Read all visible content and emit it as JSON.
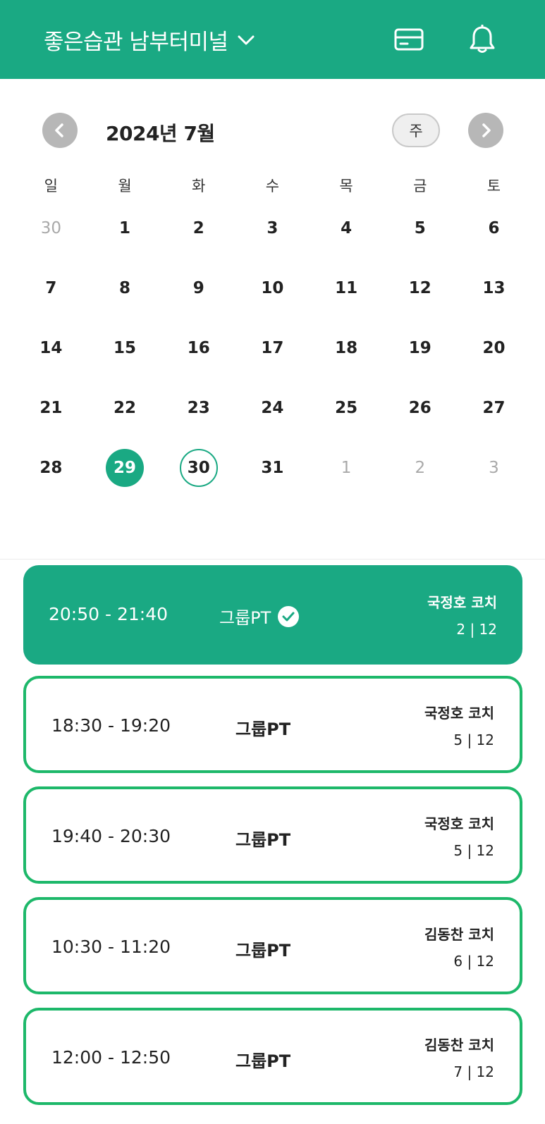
{
  "header": {
    "gym_name": "좋은습관 남부터미널",
    "icons": [
      "chevron-down-icon",
      "membership-card-icon",
      "bell-icon"
    ],
    "bg_color": "#1aa983"
  },
  "calendar": {
    "month_label": "2024년 7월",
    "view_toggle": "주",
    "weekdays": [
      "일",
      "월",
      "화",
      "수",
      "목",
      "금",
      "토"
    ],
    "weeks": [
      [
        "30",
        "1",
        "2",
        "3",
        "4",
        "5",
        "6"
      ],
      [
        "7",
        "8",
        "9",
        "10",
        "11",
        "12",
        "13"
      ],
      [
        "14",
        "15",
        "16",
        "17",
        "18",
        "19",
        "20"
      ],
      [
        "21",
        "22",
        "23",
        "24",
        "25",
        "26",
        "27"
      ],
      [
        "28",
        "29",
        "30",
        "31",
        "1",
        "2",
        "3"
      ]
    ],
    "selected_day": "29",
    "today": "30"
  },
  "classes": [
    {
      "time": "20:50 - 21:40",
      "type": "그룹PT",
      "coach": "국정호 코치",
      "capacity": "2 | 12",
      "reserved": true
    },
    {
      "time": "18:30 - 19:20",
      "type": "그룹PT",
      "coach": "국정호 코치",
      "capacity": "5 | 12",
      "reserved": false
    },
    {
      "time": "19:40 - 20:30",
      "type": "그룹PT",
      "coach": "국정호 코치",
      "capacity": "5 | 12",
      "reserved": false
    },
    {
      "time": "10:30 - 11:20",
      "type": "그룹PT",
      "coach": "김동찬 코치",
      "capacity": "6 | 12",
      "reserved": false
    },
    {
      "time": "12:00 - 12:50",
      "type": "그룹PT",
      "coach": "김동찬 코치",
      "capacity": "7 | 12",
      "reserved": false
    }
  ],
  "colors": {
    "accent": "#1aa983",
    "outline": "#1db86a",
    "muted": "#a9a9a9"
  }
}
